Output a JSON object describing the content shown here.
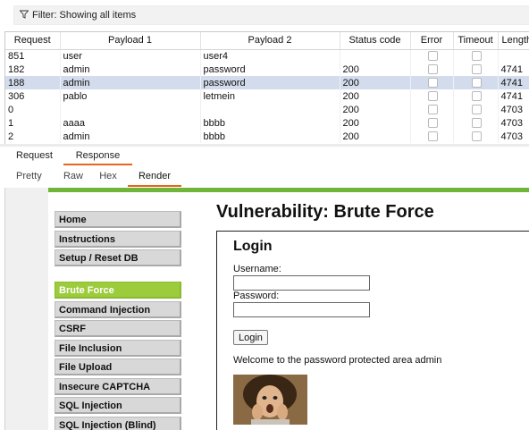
{
  "filter": {
    "text": "Filter: Showing all items",
    "icon": "funnel-icon"
  },
  "table": {
    "columns": [
      "Request",
      "Payload 1",
      "Payload 2",
      "Status code",
      "Error",
      "Timeout",
      "Length"
    ],
    "rows": [
      {
        "request": "851",
        "payload1": "user",
        "payload2": "user4",
        "status": "",
        "length": ""
      },
      {
        "request": "182",
        "payload1": "admin",
        "payload2": "password",
        "status": "200",
        "length": "4741"
      },
      {
        "request": "188",
        "payload1": "admin",
        "payload2": "password",
        "status": "200",
        "length": "4741",
        "selected": true
      },
      {
        "request": "306",
        "payload1": "pablo",
        "payload2": "letmein",
        "status": "200",
        "length": "4741"
      },
      {
        "request": "0",
        "payload1": "",
        "payload2": "",
        "status": "200",
        "length": "4703"
      },
      {
        "request": "1",
        "payload1": "aaaa",
        "payload2": "bbbb",
        "status": "200",
        "length": "4703"
      },
      {
        "request": "2",
        "payload1": "admin",
        "payload2": "bbbb",
        "status": "200",
        "length": "4703"
      }
    ]
  },
  "message_tabs": {
    "request": "Request",
    "response": "Response",
    "active": "Response"
  },
  "view_tabs": {
    "pretty": "Pretty",
    "raw": "Raw",
    "hex": "Hex",
    "render": "Render",
    "active": "Render"
  },
  "dvwa": {
    "menu": {
      "home": "Home",
      "instructions": "Instructions",
      "setup": "Setup / Reset DB",
      "brute_force": "Brute Force",
      "command_injection": "Command Injection",
      "csrf": "CSRF",
      "file_inclusion": "File Inclusion",
      "file_upload": "File Upload",
      "insecure_captcha": "Insecure CAPTCHA",
      "sql_injection": "SQL Injection",
      "sql_injection_blind": "SQL Injection (Blind)"
    },
    "page_title": "Vulnerability: Brute Force",
    "login": {
      "title": "Login",
      "username_label": "Username:",
      "password_label": "Password:",
      "button": "Login",
      "welcome": "Welcome to the password protected area admin"
    },
    "accent_color": "#9ccc3c"
  },
  "colors": {
    "selected_row": "#d2dcec",
    "tab_underline": "#e8651a",
    "green_bar": "#6fb53a"
  }
}
